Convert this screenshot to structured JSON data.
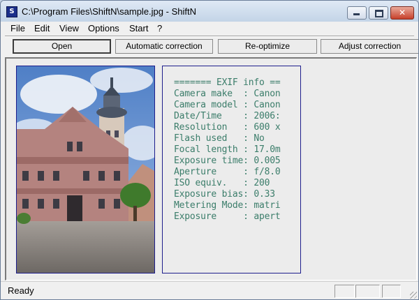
{
  "window": {
    "icon_letter": "S",
    "title": "C:\\Program Files\\ShiftN\\sample.jpg - ShiftN"
  },
  "menu": [
    "File",
    "Edit",
    "View",
    "Options",
    "Start",
    "?"
  ],
  "toolbar": {
    "open": "Open",
    "auto_correction": "Automatic correction",
    "reoptimize": "Re-optimize",
    "adjust_correction": "Adjust correction"
  },
  "exif_lines": [
    "======= EXIF info ==",
    "Camera make  : Canon",
    "Camera model : Canon",
    "Date/Time    : 2006:",
    "Resolution   : 600 x",
    "Flash used   : No",
    "Focal length : 17.0m",
    "Exposure time: 0.005",
    "Aperture     : f/8.0",
    "ISO equiv.   : 200",
    "Exposure bias: 0.33",
    "Metering Mode: matri",
    "Exposure     : apert"
  ],
  "status": {
    "text": "Ready"
  }
}
